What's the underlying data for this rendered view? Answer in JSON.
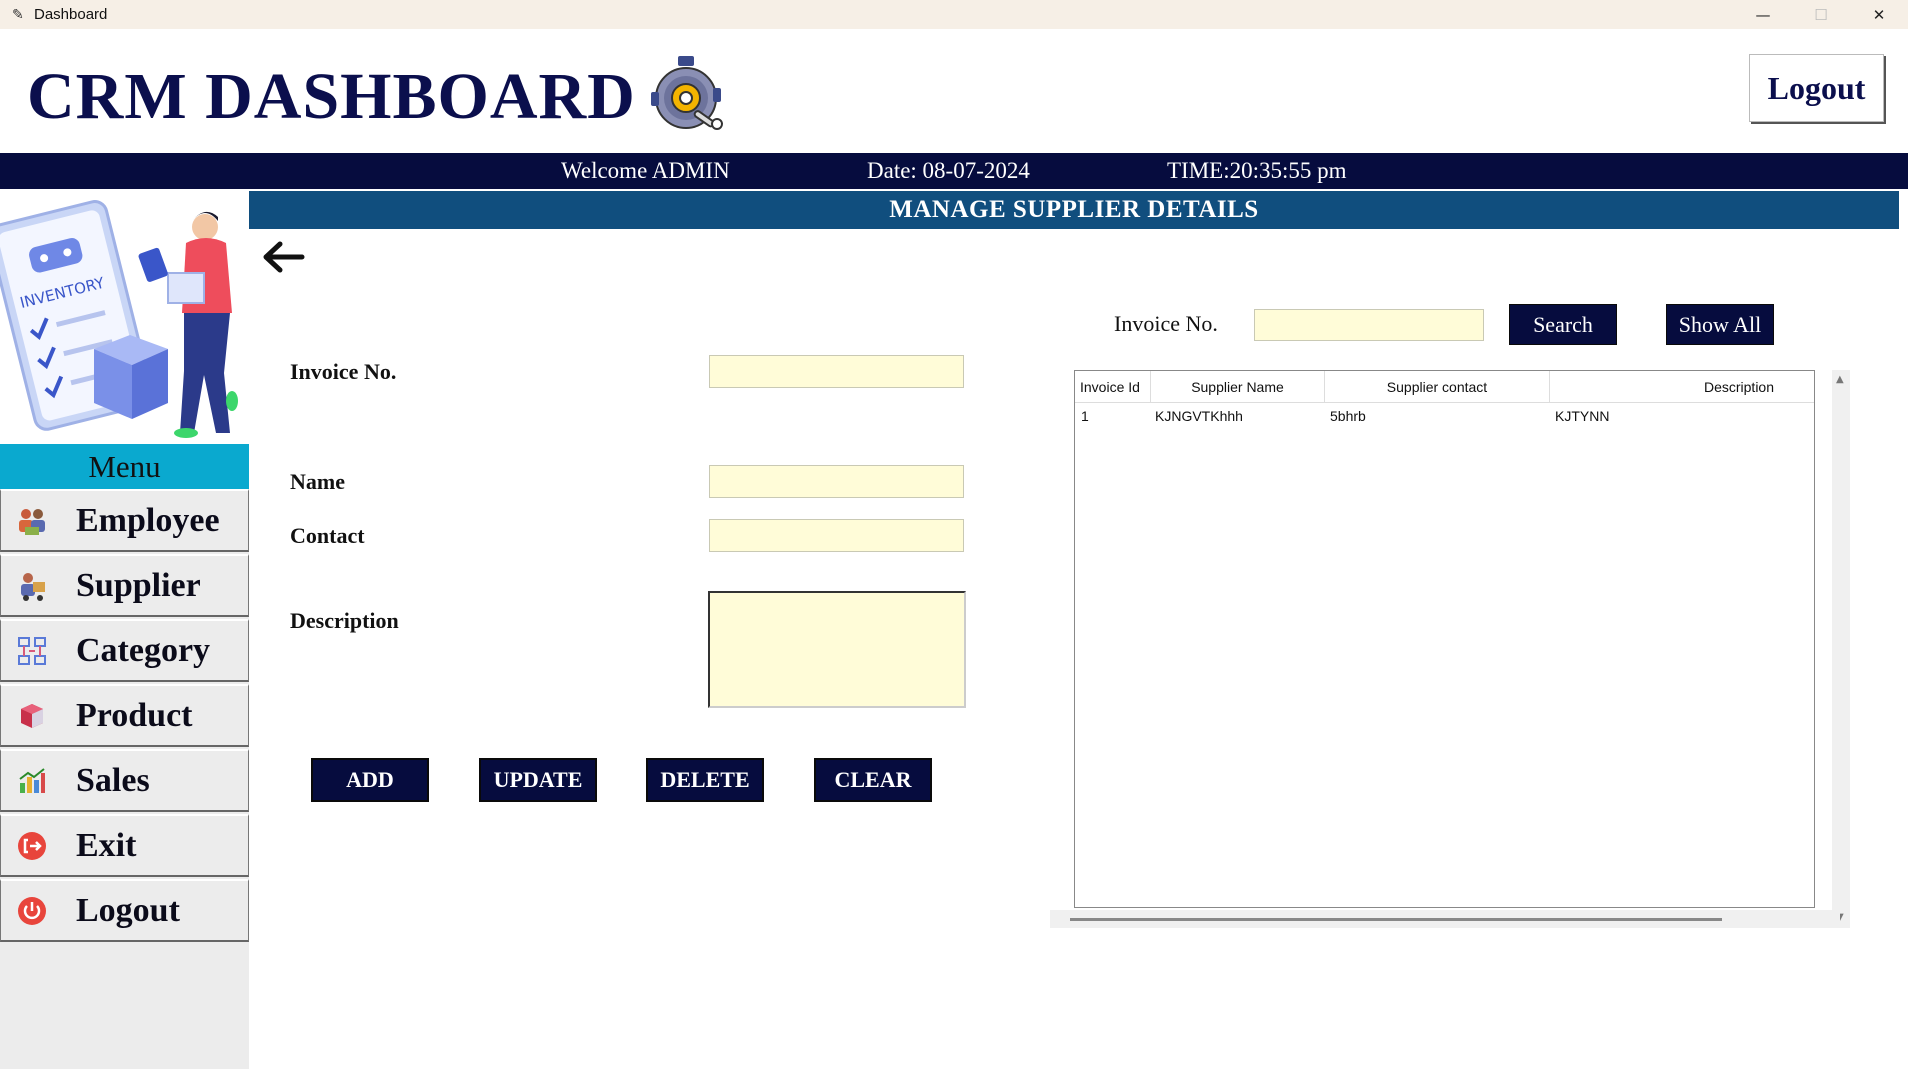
{
  "window": {
    "title": "Dashboard",
    "app_icon": "feather-icon",
    "controls": {
      "minimize": "—",
      "maximize": "☐",
      "close": "✕"
    }
  },
  "header": {
    "title": "CRM DASHBOARD",
    "logo_icon": "gear-robot-icon",
    "logout_label": "Logout"
  },
  "infobar": {
    "welcome": "Welcome ADMIN",
    "date": "Date: 08-07-2024",
    "time": "TIME:20:35:55 pm"
  },
  "sidebar": {
    "hero_image": "inventory-illustration",
    "hero_text": "INVENTORY",
    "menu_title": "Menu",
    "items": [
      {
        "label": "Employee",
        "icon": "employees-icon"
      },
      {
        "label": "Supplier",
        "icon": "supplier-icon"
      },
      {
        "label": "Category",
        "icon": "category-icon"
      },
      {
        "label": "Product",
        "icon": "product-box-icon"
      },
      {
        "label": "Sales",
        "icon": "sales-chart-icon"
      },
      {
        "label": "Exit",
        "icon": "exit-icon"
      },
      {
        "label": "Logout",
        "icon": "power-icon"
      }
    ]
  },
  "main": {
    "section_title": "MANAGE SUPPLIER DETAILS",
    "back_icon": "arrow-left-icon",
    "form": {
      "invoice_label": "Invoice No.",
      "invoice_value": "",
      "name_label": "Name",
      "name_value": "",
      "contact_label": "Contact",
      "contact_value": "",
      "description_label": "Description",
      "description_value": ""
    },
    "actions": {
      "add": "ADD",
      "update": "UPDATE",
      "delete": "DELETE",
      "clear": "CLEAR"
    },
    "search": {
      "label": "Invoice No.",
      "value": "",
      "search_button": "Search",
      "show_all_button": "Show All"
    },
    "table": {
      "columns": [
        "Invoice Id",
        "Supplier Name",
        "Supplier contact",
        "Description"
      ],
      "rows": [
        [
          "1",
          "KJNGVTKhhh",
          "5bhrb",
          "KJTYNN"
        ]
      ]
    }
  },
  "colors": {
    "navy": "#060c3e",
    "title_navy": "#0b0f4d",
    "section_blue": "#104e7e",
    "menu_cyan": "#0aa9cf",
    "input_yellow": "#fffcd8"
  }
}
